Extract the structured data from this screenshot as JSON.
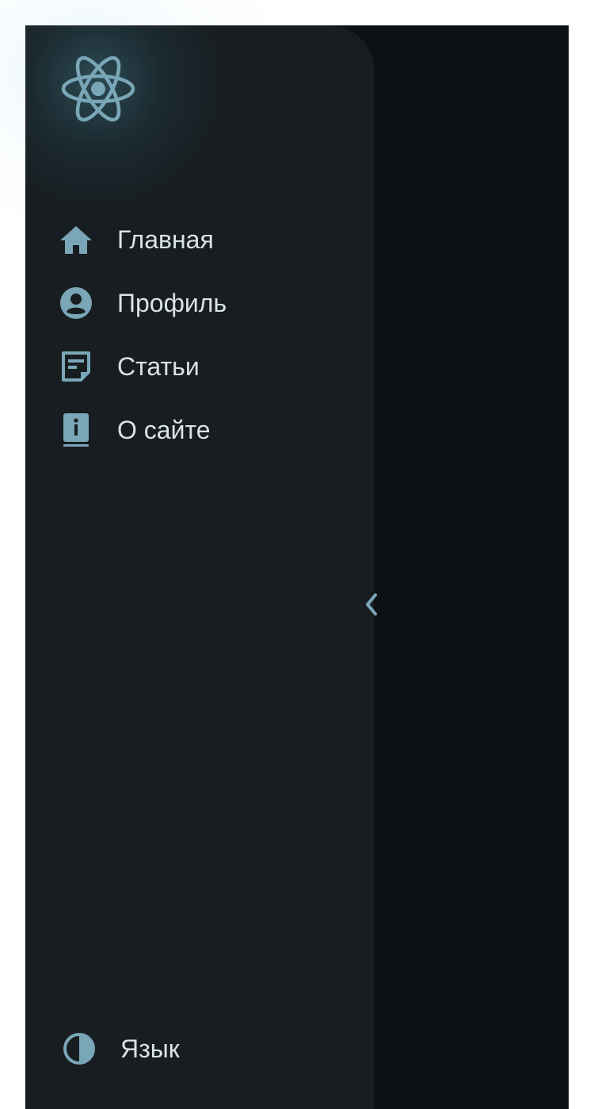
{
  "sidebar": {
    "logo_icon": "atom-icon",
    "items": [
      {
        "label": "Главная",
        "icon": "home-icon"
      },
      {
        "label": "Профиль",
        "icon": "account-circle-icon"
      },
      {
        "label": "Статьи",
        "icon": "article-note-icon"
      },
      {
        "label": "О сайте",
        "icon": "info-book-icon"
      }
    ],
    "collapse_icon": "chevron-left-icon",
    "language": {
      "label": "Язык",
      "icon": "contrast-half-icon"
    }
  },
  "colors": {
    "accent": "#7aa7b8",
    "sidebar_bg": "#171d20",
    "main_bg": "#0d1114",
    "text": "#d9e2e6"
  }
}
